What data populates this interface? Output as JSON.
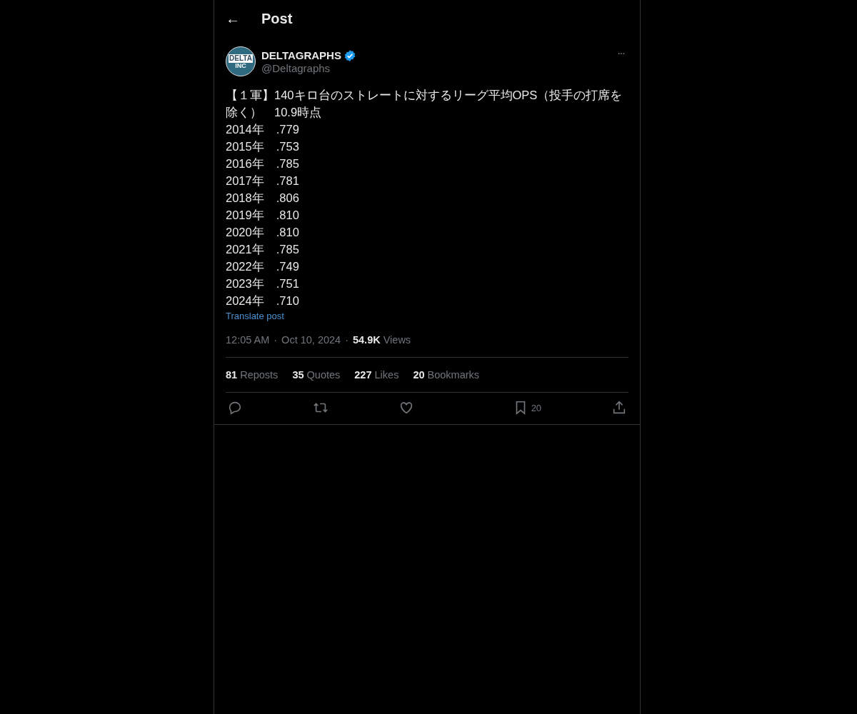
{
  "header": {
    "back": "←",
    "title": "Post"
  },
  "author": {
    "name": "DELTAGRAPHS",
    "verified": true,
    "handle": "@Deltagraphs",
    "avatar_text": "DELTA",
    "avatar_sub": "INC"
  },
  "more": "···",
  "post": {
    "headline": "【１軍】140キロ台のストレートに対するリーグ平均OPS（投手の打席を除く）　10.9時点",
    "lines": [
      "2014年　.779",
      "2015年　.753",
      "2016年　.785",
      "2017年　.781",
      "2018年　.806",
      "2019年　.810",
      "2020年　.810",
      "2021年　.785",
      "2022年　.749",
      "2023年　.751",
      "2024年　.710"
    ],
    "translate": "Translate post"
  },
  "meta": {
    "time": "12:05 AM",
    "sep": "·",
    "date": "Oct 10, 2024",
    "views_count": "54.9K",
    "views_label": "Views"
  },
  "stats": [
    {
      "count": "81",
      "label": "Reposts"
    },
    {
      "count": "35",
      "label": "Quotes"
    },
    {
      "count": "227",
      "label": "Likes"
    },
    {
      "count": "20",
      "label": "Bookmarks"
    }
  ],
  "actions": [
    {
      "kind": "reply"
    },
    {
      "kind": "repost"
    },
    {
      "kind": "like"
    },
    {
      "kind": "bookmark",
      "count": "20"
    },
    {
      "kind": "share"
    }
  ]
}
